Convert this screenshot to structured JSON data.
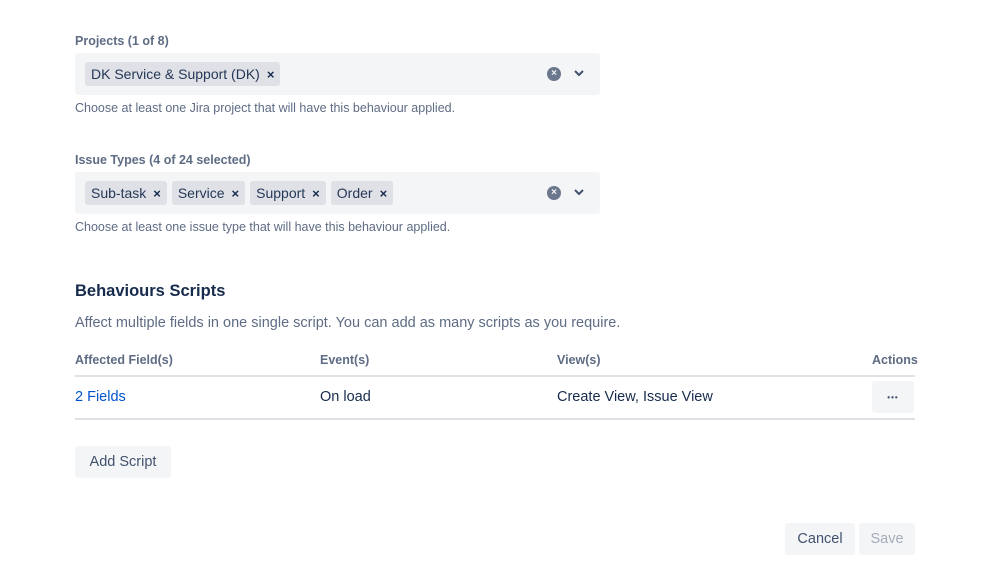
{
  "projects": {
    "label": "Projects (1 of 8)",
    "tags": [
      "DK Service & Support (DK)"
    ],
    "help": "Choose at least one Jira project that will have this behaviour applied."
  },
  "issue_types": {
    "label": "Issue Types (4 of 24 selected)",
    "tags": [
      "Sub-task",
      "Service",
      "Support",
      "Order"
    ],
    "help": "Choose at least one issue type that will have this behaviour applied."
  },
  "icons": {
    "tag_remove": "×",
    "clear": "×",
    "more": "•••"
  },
  "scripts": {
    "title": "Behaviours Scripts",
    "description": "Affect multiple fields in one single script. You can add as many scripts as you require.",
    "columns": [
      "Affected Field(s)",
      "Event(s)",
      "View(s)",
      "Actions"
    ],
    "rows": [
      {
        "fields": "2 Fields",
        "events": "On load",
        "views": "Create View, Issue View"
      }
    ],
    "add_label": "Add Script"
  },
  "footer": {
    "cancel_label": "Cancel",
    "save_label": "Save"
  }
}
